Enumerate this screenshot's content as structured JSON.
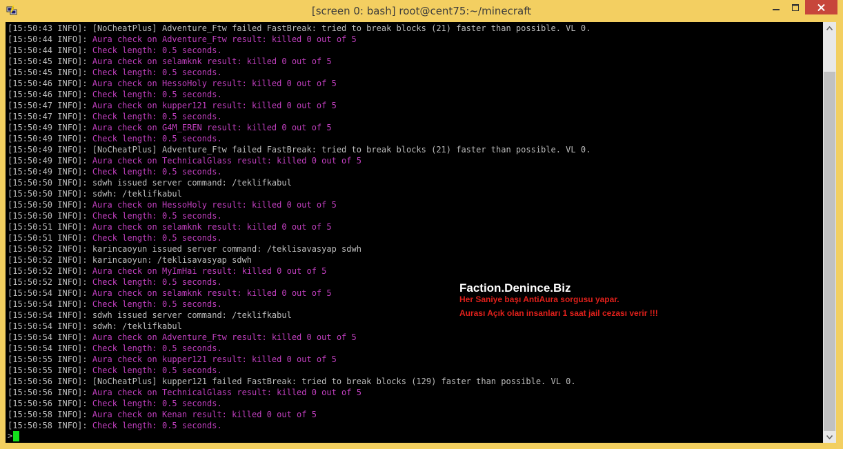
{
  "window": {
    "title": "[screen 0: bash] root@cent75:~/minecraft",
    "colors": {
      "frame": "#f3cf61",
      "close": "#c7463b"
    }
  },
  "terminal": {
    "lines": [
      {
        "ts": "[15:50:43 INFO]: ",
        "msg": "[NoCheatPlus] Adventure_Ftw failed FastBreak: tried to break blocks (21) faster than possible. VL 0.",
        "color": "gray"
      },
      {
        "ts": "[15:50:44 INFO]: ",
        "msg": "Aura check on Adventure_Ftw result: killed 0 out of 5",
        "color": "magenta"
      },
      {
        "ts": "[15:50:44 INFO]: ",
        "msg": "Check length: 0.5 seconds.",
        "color": "magenta"
      },
      {
        "ts": "[15:50:45 INFO]: ",
        "msg": "Aura check on selamknk result: killed 0 out of 5",
        "color": "magenta"
      },
      {
        "ts": "[15:50:45 INFO]: ",
        "msg": "Check length: 0.5 seconds.",
        "color": "magenta"
      },
      {
        "ts": "[15:50:46 INFO]: ",
        "msg": "Aura check on HessoHoly result: killed 0 out of 5",
        "color": "magenta"
      },
      {
        "ts": "[15:50:46 INFO]: ",
        "msg": "Check length: 0.5 seconds.",
        "color": "magenta"
      },
      {
        "ts": "[15:50:47 INFO]: ",
        "msg": "Aura check on kupper121 result: killed 0 out of 5",
        "color": "magenta"
      },
      {
        "ts": "[15:50:47 INFO]: ",
        "msg": "Check length: 0.5 seconds.",
        "color": "magenta"
      },
      {
        "ts": "[15:50:49 INFO]: ",
        "msg": "Aura check on G4M_EREN result: killed 0 out of 5",
        "color": "magenta"
      },
      {
        "ts": "[15:50:49 INFO]: ",
        "msg": "Check length: 0.5 seconds.",
        "color": "magenta"
      },
      {
        "ts": "[15:50:49 INFO]: ",
        "msg": "[NoCheatPlus] Adventure_Ftw failed FastBreak: tried to break blocks (21) faster than possible. VL 0.",
        "color": "gray"
      },
      {
        "ts": "[15:50:49 INFO]: ",
        "msg": "Aura check on TechnicalGlass result: killed 0 out of 5",
        "color": "magenta"
      },
      {
        "ts": "[15:50:49 INFO]: ",
        "msg": "Check length: 0.5 seconds.",
        "color": "magenta"
      },
      {
        "ts": "[15:50:50 INFO]: ",
        "msg": "sdwh issued server command: /teklifkabul",
        "color": "gray"
      },
      {
        "ts": "[15:50:50 INFO]: ",
        "msg": "sdwh: /teklifkabul",
        "color": "gray"
      },
      {
        "ts": "[15:50:50 INFO]: ",
        "msg": "Aura check on HessoHoly result: killed 0 out of 5",
        "color": "magenta"
      },
      {
        "ts": "[15:50:50 INFO]: ",
        "msg": "Check length: 0.5 seconds.",
        "color": "magenta"
      },
      {
        "ts": "[15:50:51 INFO]: ",
        "msg": "Aura check on selamknk result: killed 0 out of 5",
        "color": "magenta"
      },
      {
        "ts": "[15:50:51 INFO]: ",
        "msg": "Check length: 0.5 seconds.",
        "color": "magenta"
      },
      {
        "ts": "[15:50:52 INFO]: ",
        "msg": "karincaoyun issued server command: /teklisavasyap sdwh",
        "color": "gray"
      },
      {
        "ts": "[15:50:52 INFO]: ",
        "msg": "karincaoyun: /teklisavasyap sdwh",
        "color": "gray"
      },
      {
        "ts": "[15:50:52 INFO]: ",
        "msg": "Aura check on MyImHai result: killed 0 out of 5",
        "color": "magenta"
      },
      {
        "ts": "[15:50:52 INFO]: ",
        "msg": "Check length: 0.5 seconds.",
        "color": "magenta"
      },
      {
        "ts": "[15:50:54 INFO]: ",
        "msg": "Aura check on selamknk result: killed 0 out of 5",
        "color": "magenta"
      },
      {
        "ts": "[15:50:54 INFO]: ",
        "msg": "Check length: 0.5 seconds.",
        "color": "magenta"
      },
      {
        "ts": "[15:50:54 INFO]: ",
        "msg": "sdwh issued server command: /teklifkabul",
        "color": "gray"
      },
      {
        "ts": "[15:50:54 INFO]: ",
        "msg": "sdwh: /teklifkabul",
        "color": "gray"
      },
      {
        "ts": "[15:50:54 INFO]: ",
        "msg": "Aura check on Adventure_Ftw result: killed 0 out of 5",
        "color": "magenta"
      },
      {
        "ts": "[15:50:54 INFO]: ",
        "msg": "Check length: 0.5 seconds.",
        "color": "magenta"
      },
      {
        "ts": "[15:50:55 INFO]: ",
        "msg": "Aura check on kupper121 result: killed 0 out of 5",
        "color": "magenta"
      },
      {
        "ts": "[15:50:55 INFO]: ",
        "msg": "Check length: 0.5 seconds.",
        "color": "magenta"
      },
      {
        "ts": "[15:50:56 INFO]: ",
        "msg": "[NoCheatPlus] kupper121 failed FastBreak: tried to break blocks (129) faster than possible. VL 0.",
        "color": "gray"
      },
      {
        "ts": "[15:50:56 INFO]: ",
        "msg": "Aura check on TechnicalGlass result: killed 0 out of 5",
        "color": "magenta"
      },
      {
        "ts": "[15:50:56 INFO]: ",
        "msg": "Check length: 0.5 seconds.",
        "color": "magenta"
      },
      {
        "ts": "[15:50:58 INFO]: ",
        "msg": "Aura check on Kenan result: killed 0 out of 5",
        "color": "magenta"
      },
      {
        "ts": "[15:50:58 INFO]: ",
        "msg": "Check length: 0.5 seconds.",
        "color": "magenta"
      }
    ],
    "prompt": ">",
    "colors": {
      "gray": "#bdbdbd",
      "magenta": "#c13fbf",
      "cursor": "#13e01b",
      "background": "#000000"
    }
  },
  "overlay": {
    "title": "Faction.Denince.Biz",
    "line1": "Her Saniye başı AntiAura sorgusu yapar.",
    "line2": "Aurası Açık olan insanları 1 saat jail cezası verir !!!",
    "colors": {
      "title": "#ffffff",
      "text": "#e0201b"
    }
  }
}
